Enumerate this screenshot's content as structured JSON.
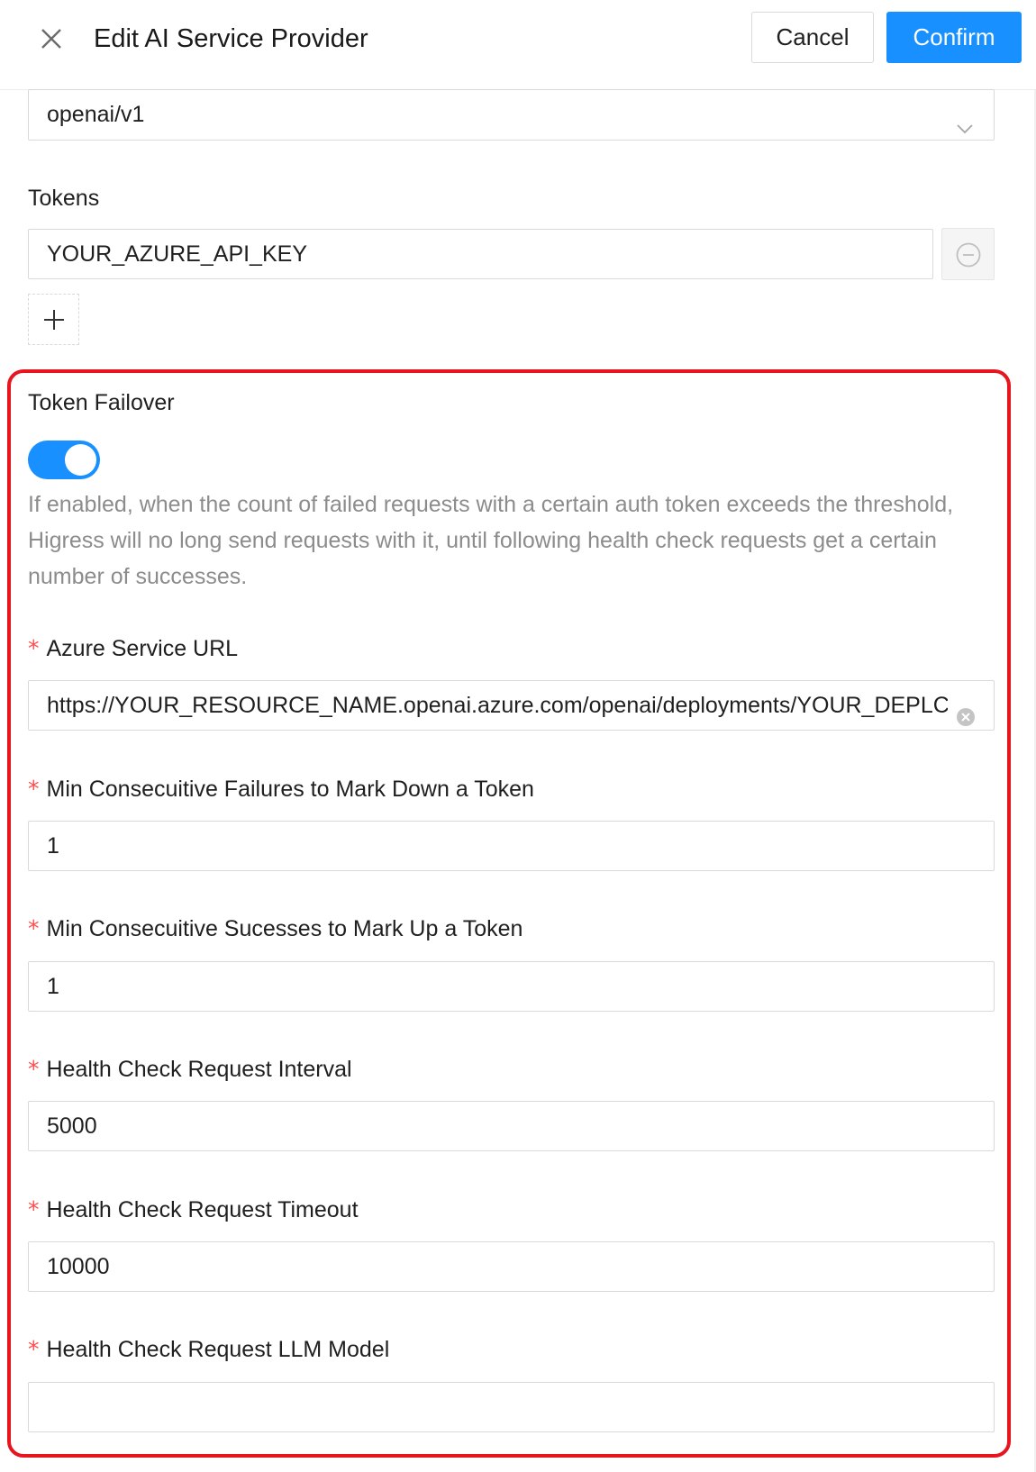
{
  "header": {
    "title": "Edit AI Service Provider",
    "cancel_label": "Cancel",
    "confirm_label": "Confirm",
    "close_icon": "close-icon"
  },
  "form": {
    "protocol": {
      "value": "openai/v1",
      "icon": "chevron-down-icon"
    },
    "tokens": {
      "label": "Tokens",
      "items": [
        "YOUR_AZURE_API_KEY"
      ],
      "remove_icon": "minus-circle-icon",
      "add_icon": "plus-icon"
    },
    "token_failover": {
      "label": "Token Failover",
      "enabled": true,
      "help": "If enabled, when the count of failed requests with a certain auth token exceeds the threshold, Higress will no long send requests with it, until following health check requests get a certain number of successes."
    },
    "azure_service_url": {
      "required_mark": "*",
      "label": "Azure Service URL",
      "value": "https://YOUR_RESOURCE_NAME.openai.azure.com/openai/deployments/YOUR_DEPLC",
      "clear_icon": "clear-circle-icon"
    },
    "min_failures": {
      "required_mark": "*",
      "label": "Min Consecuitive Failures to Mark Down a Token",
      "value": "1"
    },
    "min_successes": {
      "required_mark": "*",
      "label": "Min Consecuitive Sucesses to Mark Up a Token",
      "value": "1"
    },
    "health_interval": {
      "required_mark": "*",
      "label": "Health Check Request Interval",
      "value": "5000"
    },
    "health_timeout": {
      "required_mark": "*",
      "label": "Health Check Request Timeout",
      "value": "10000"
    },
    "health_model": {
      "required_mark": "*",
      "label": "Health Check Request LLM Model",
      "value": ""
    }
  },
  "colors": {
    "primary": "#1890ff",
    "required": "#ff4d4f",
    "highlight": "#e8141e",
    "help_text": "#8c8c8c"
  }
}
